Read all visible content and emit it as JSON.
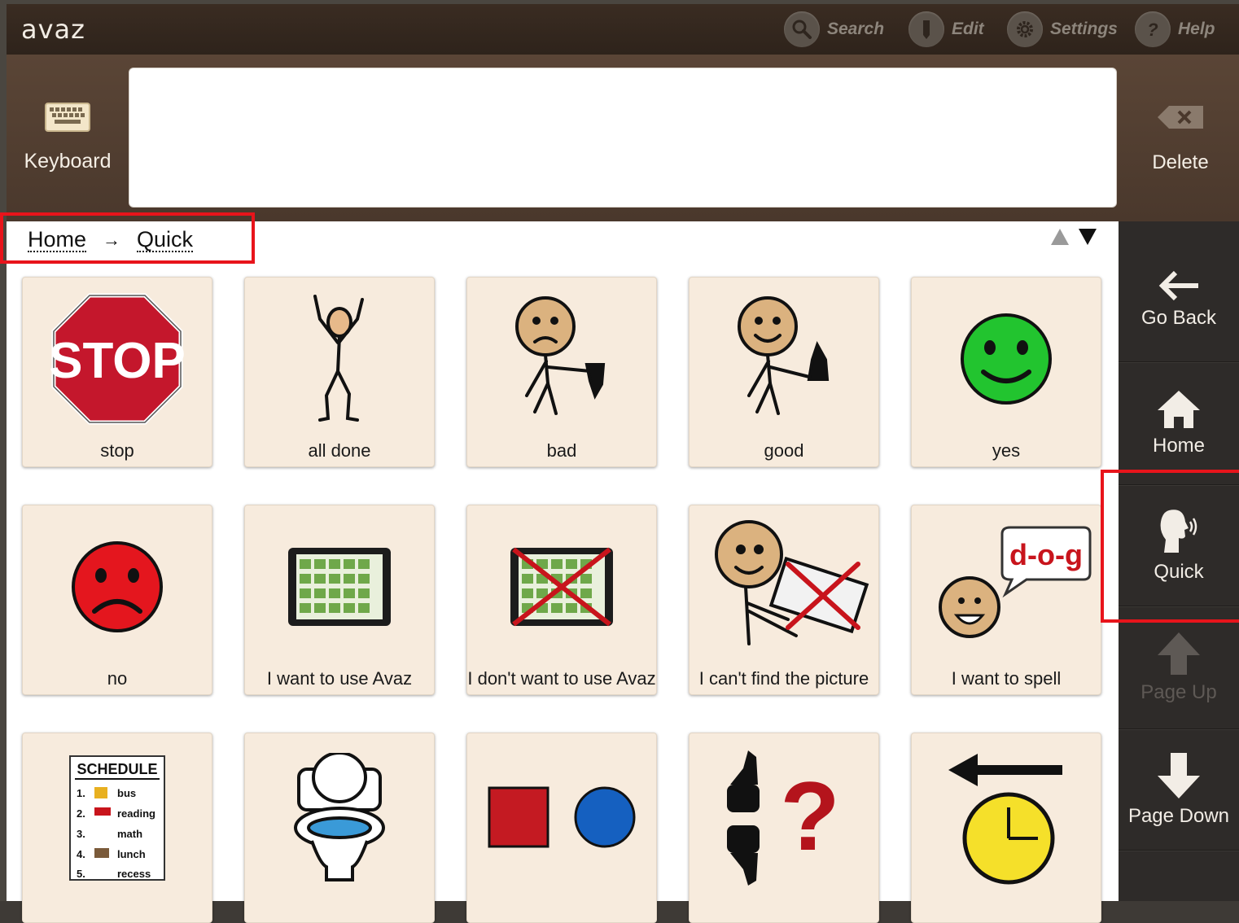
{
  "app": {
    "logo": "avaz"
  },
  "toolbar": {
    "search_label": "Search",
    "edit_label": "Edit",
    "settings_label": "Settings",
    "help_label": "Help"
  },
  "message_bar": {
    "keyboard_label": "Keyboard",
    "message_text": "",
    "delete_label": "Delete"
  },
  "breadcrumb": {
    "items": [
      "Home",
      "Quick"
    ],
    "separator": "→"
  },
  "tiles": [
    {
      "label": "stop",
      "icon": "stop-sign-icon"
    },
    {
      "label": "all done",
      "icon": "all-done-figure-icon"
    },
    {
      "label": "bad",
      "icon": "thumbs-down-figure-icon"
    },
    {
      "label": "good",
      "icon": "thumbs-up-figure-icon"
    },
    {
      "label": "yes",
      "icon": "green-smiley-icon"
    },
    {
      "label": "no",
      "icon": "red-frowny-icon"
    },
    {
      "label": "I want to use Avaz",
      "icon": "tablet-icon"
    },
    {
      "label": "I don't want to use Avaz",
      "icon": "tablet-crossed-icon"
    },
    {
      "label": "I can't find the picture",
      "icon": "cant-find-picture-icon"
    },
    {
      "label": "I want to spell",
      "icon": "spell-dog-icon"
    },
    {
      "label": "",
      "icon": "schedule-icon"
    },
    {
      "label": "",
      "icon": "toilet-icon"
    },
    {
      "label": "",
      "icon": "shapes-icon"
    },
    {
      "label": "",
      "icon": "thumbs-question-icon"
    },
    {
      "label": "",
      "icon": "clock-back-icon"
    }
  ],
  "schedule": {
    "title": "SCHEDULE",
    "rows": [
      {
        "num": "1.",
        "text": "bus"
      },
      {
        "num": "2.",
        "text": "reading"
      },
      {
        "num": "3.",
        "text": "math"
      },
      {
        "num": "4.",
        "text": "lunch"
      },
      {
        "num": "5.",
        "text": "recess"
      }
    ]
  },
  "stop_text": "STOP",
  "dog_text": "d-o-g",
  "sidebar": {
    "go_back": "Go Back",
    "home": "Home",
    "quick": "Quick",
    "page_up": "Page Up",
    "page_down": "Page Down"
  },
  "colors": {
    "highlight_red": "#e8141b",
    "tile_bg": "#f7ebdd",
    "sidebar_bg": "#2e2b29"
  }
}
